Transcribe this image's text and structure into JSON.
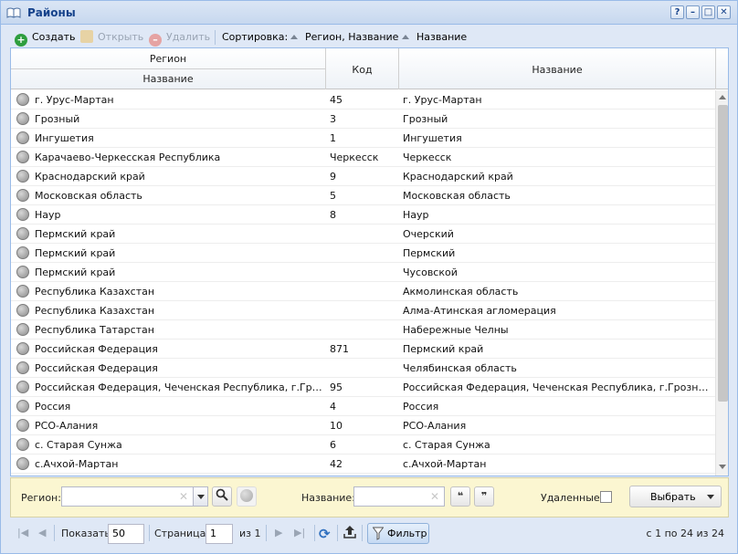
{
  "window": {
    "title": "Районы",
    "controls": [
      "?",
      "–",
      "□",
      "✕"
    ]
  },
  "toolbar": {
    "create_label": "Создать",
    "open_label": "Открыть",
    "delete_label": "Удалить",
    "sort_label": "Сортировка:",
    "sort_1": "Регион, Название",
    "sort_2": "Название"
  },
  "grid": {
    "headers": {
      "region_group": "Регион",
      "region_name": "Название",
      "code": "Код",
      "name": "Название"
    },
    "rows": [
      {
        "region": "г. Урус-Мартан",
        "code": "45",
        "name": "г. Урус-Мартан"
      },
      {
        "region": "Грозный",
        "code": "3",
        "name": "Грозный"
      },
      {
        "region": "Ингушетия",
        "code": "1",
        "name": "Ингушетия"
      },
      {
        "region": "Карачаево-Черкесская Республика",
        "code": "Черкесск",
        "name": "Черкесск"
      },
      {
        "region": "Краснодарский край",
        "code": "9",
        "name": "Краснодарский край"
      },
      {
        "region": "Московская область",
        "code": "5",
        "name": "Московская область"
      },
      {
        "region": "Наур",
        "code": "8",
        "name": "Наур"
      },
      {
        "region": "Пермский край",
        "code": "",
        "name": "Очерский"
      },
      {
        "region": "Пермский край",
        "code": "",
        "name": "Пермский"
      },
      {
        "region": "Пермский край",
        "code": "",
        "name": "Чусовской"
      },
      {
        "region": "Республика Казахстан",
        "code": "",
        "name": "Акмолинская область"
      },
      {
        "region": "Республика Казахстан",
        "code": "",
        "name": "Алма-Атинская агломерация"
      },
      {
        "region": "Республика Татарстан",
        "code": "",
        "name": "Набережные Челны"
      },
      {
        "region": "Российская Федерация",
        "code": "871",
        "name": "Пермский край"
      },
      {
        "region": "Российская Федерация",
        "code": "",
        "name": "Челябинская область"
      },
      {
        "region": "Российская Федерация, Чеченская Республика, г.Грозный, ...",
        "code": "95",
        "name": "Российская Федерация, Чеченская Республика, г.Грозный, Лен..."
      },
      {
        "region": "Россия",
        "code": "4",
        "name": "Россия"
      },
      {
        "region": "РСО-Алания",
        "code": "10",
        "name": "РСО-Алания"
      },
      {
        "region": "с. Старая Сунжа",
        "code": "6",
        "name": "с. Старая Сунжа"
      },
      {
        "region": "с.Ачхой-Мартан",
        "code": "42",
        "name": "с.Ачхой-Мартан"
      }
    ]
  },
  "filter": {
    "region_label": "Регион:",
    "region_value": "",
    "name_label": "Название:",
    "name_value": "",
    "quote_open": "❝",
    "quote_close": "❞",
    "deleted_label": "Удаленные:",
    "deleted_checked": false,
    "select_label": "Выбрать"
  },
  "paging": {
    "show_label": "Показать",
    "page_size": "50",
    "page_label": "Страница",
    "page_value": "1",
    "of_label": "из 1",
    "filter_label": "Фильтр",
    "summary": "с 1 по 24 из 24"
  },
  "colors": {
    "frame": "#99bbe8",
    "panel": "#dfe8f6",
    "title_text": "#15428b",
    "filter_bg": "#fbf6d1",
    "create_icon": "#2f9e3f",
    "delete_icon": "#e5a3a3"
  }
}
